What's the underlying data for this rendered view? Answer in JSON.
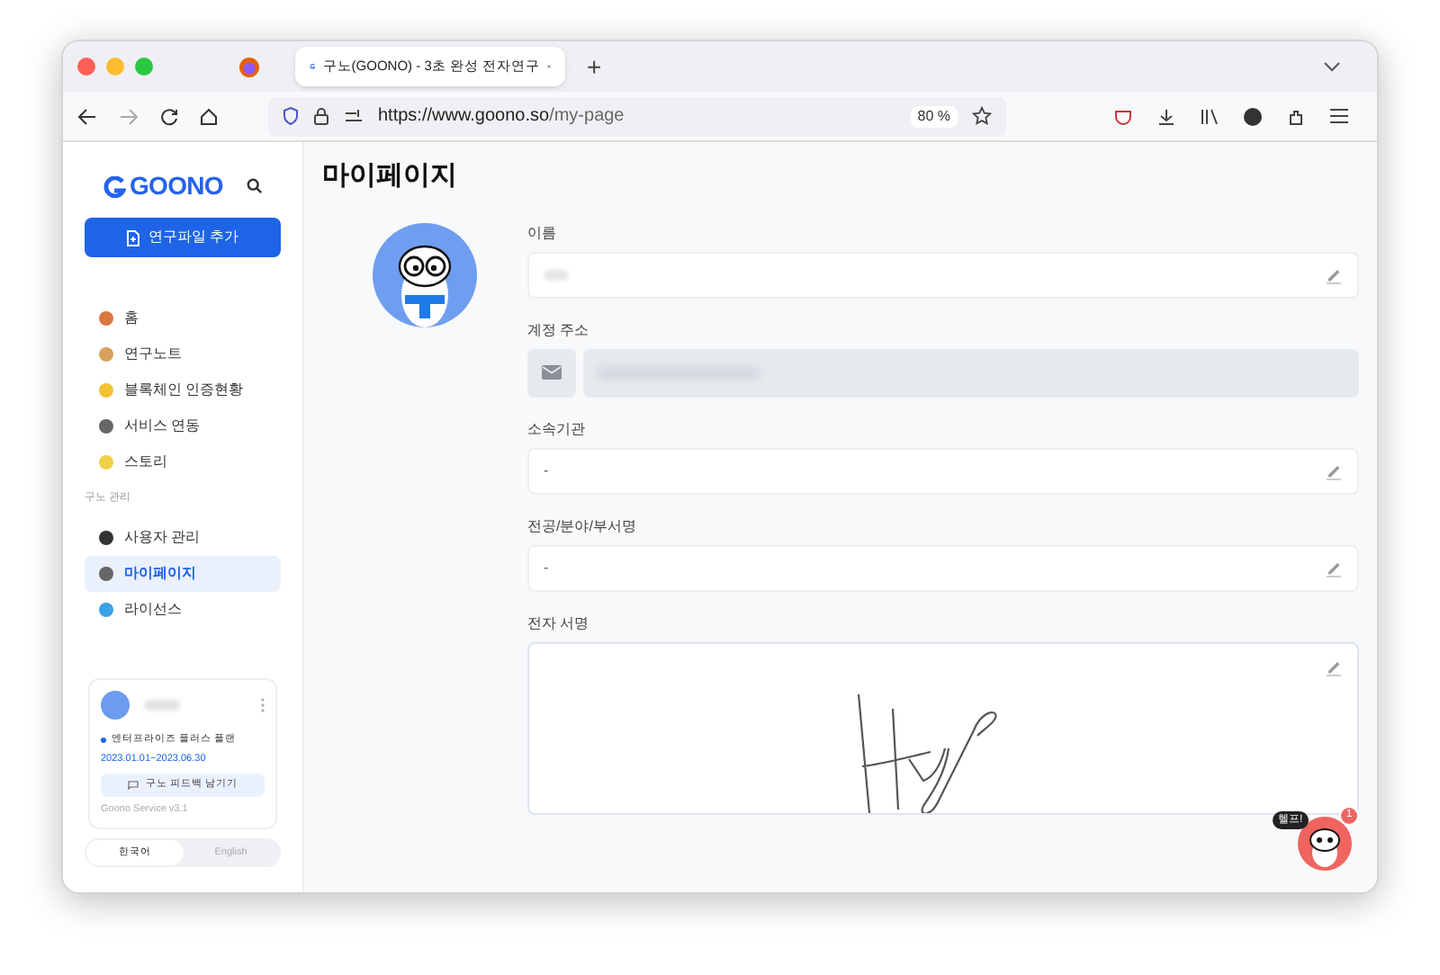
{
  "browser": {
    "tab": {
      "title": "구노(GOONO) - 3초 완성 전자연구",
      "selected": true
    },
    "new_tab": "+",
    "url_host": "https://www.goono.so",
    "url_path": "/my-page",
    "zoom": "80 %"
  },
  "sidebar": {
    "logo": "GOONO",
    "primary_button": "연구파일 추가",
    "items": [
      {
        "label": "홈",
        "selected": false
      },
      {
        "label": "연구노트",
        "selected": false
      },
      {
        "label": "블록체인 인증현황",
        "selected": false
      },
      {
        "label": "서비스 연동",
        "selected": false
      },
      {
        "label": "스토리",
        "selected": false
      }
    ],
    "section_label": "구노 관리",
    "admin_items": [
      {
        "label": "사용자 관리",
        "selected": false
      },
      {
        "label": "마이페이지",
        "selected": true
      },
      {
        "label": "라이선스",
        "selected": false
      }
    ],
    "account": {
      "plan": "엔터프라이즈 플러스 플랜",
      "period": "2023.01.01~2023.06.30",
      "feedback_button": "구노 피드백 남기기",
      "version": "Goono Service v3.1"
    },
    "languages": [
      {
        "label": "한국어",
        "selected": true
      },
      {
        "label": "English",
        "selected": false
      }
    ]
  },
  "page": {
    "title": "마이페이지",
    "fields": [
      {
        "kind": "editable",
        "label": "이름"
      },
      {
        "kind": "email",
        "label": "계정 주소"
      },
      {
        "kind": "editable",
        "label": "소속기관",
        "value": "-"
      },
      {
        "kind": "editable",
        "label": "전공/분야/부서명",
        "value": "-"
      },
      {
        "kind": "signature",
        "label": "전자 서명"
      }
    ]
  },
  "help": {
    "label": "헬프!",
    "count": "1"
  }
}
